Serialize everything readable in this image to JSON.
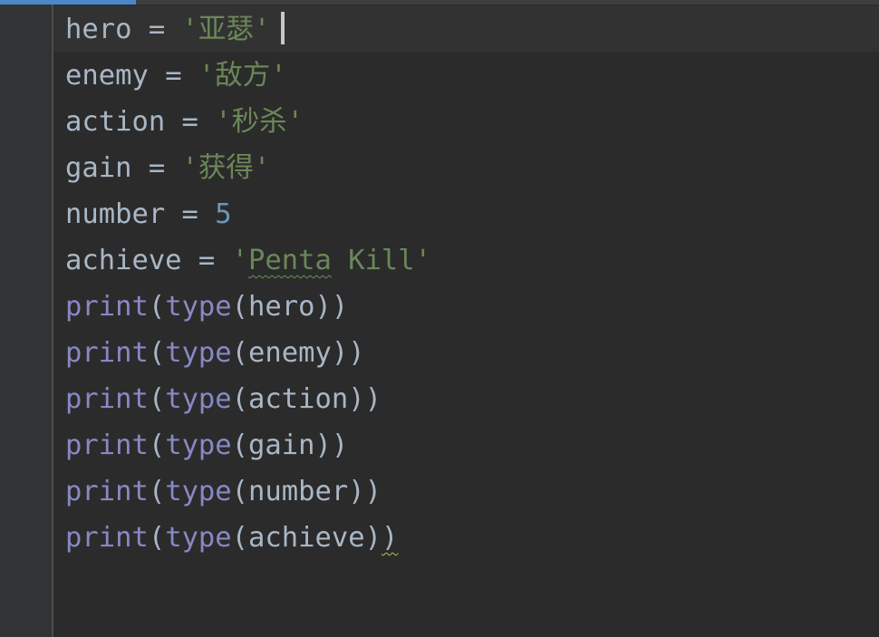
{
  "editor": {
    "language": "python",
    "theme_colors": {
      "background": "#2b2b2b",
      "gutter": "#313335",
      "identifier": "#a9b7c6",
      "builtin": "#8888c6",
      "string": "#6a8759",
      "number": "#6897bb"
    },
    "lines": [
      {
        "var": "hero",
        "op": " = ",
        "value": "'亚瑟'"
      },
      {
        "var": "enemy",
        "op": " = ",
        "value": "'敌方'"
      },
      {
        "var": "action",
        "op": " = ",
        "value": "'秒杀'"
      },
      {
        "var": "gain",
        "op": " = ",
        "value": "'获得'"
      },
      {
        "var": "number",
        "op": " = ",
        "value": "5"
      },
      {
        "var": "achieve",
        "op": " = ",
        "value_open": "'",
        "value_typo": "Penta",
        "value_rest": " Kill'"
      },
      {
        "fn": "print",
        "inner": "type",
        "arg": "hero"
      },
      {
        "fn": "print",
        "inner": "type",
        "arg": "enemy"
      },
      {
        "fn": "print",
        "inner": "type",
        "arg": "action"
      },
      {
        "fn": "print",
        "inner": "type",
        "arg": "gain"
      },
      {
        "fn": "print",
        "inner": "type",
        "arg": "number"
      },
      {
        "fn": "print",
        "inner": "type",
        "arg": "achieve"
      }
    ],
    "paren_open": "(",
    "paren_close": ")"
  }
}
